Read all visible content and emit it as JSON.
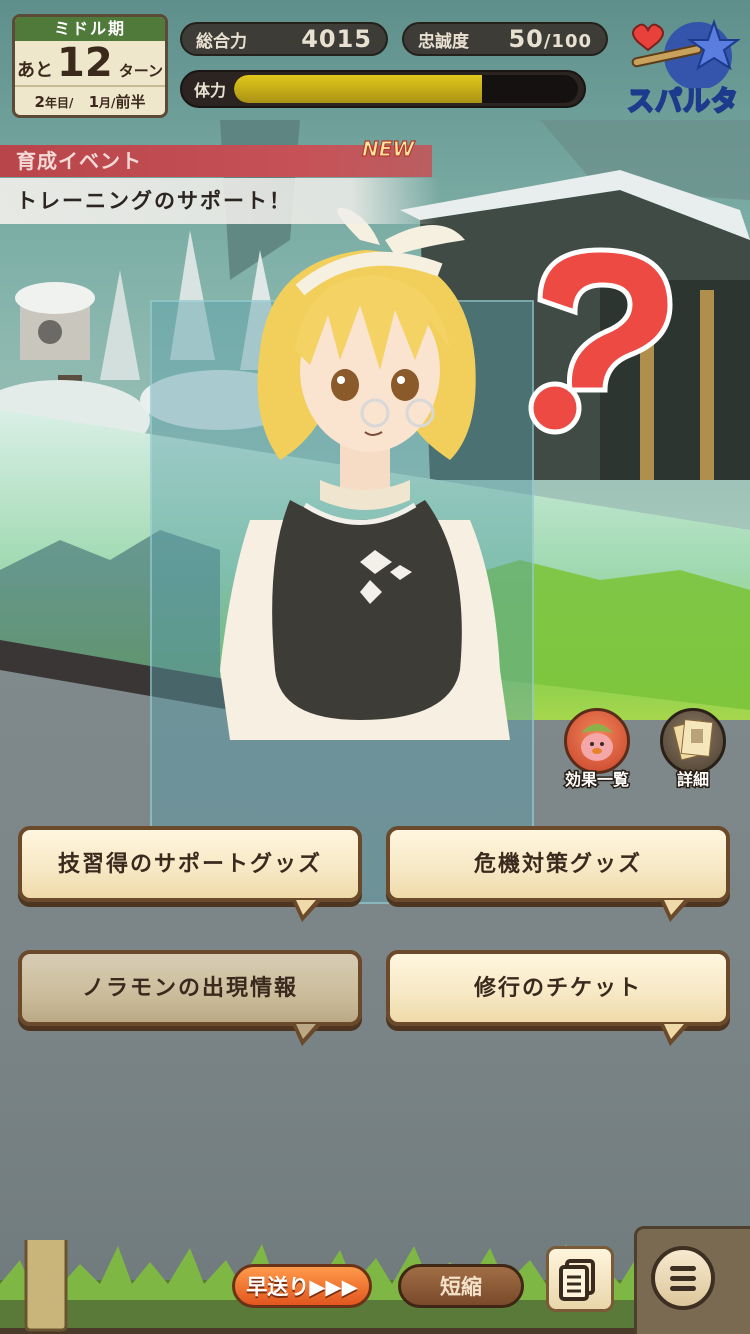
{
  "hud": {
    "period": "ミドル期",
    "turns_prefix": "あと",
    "turns_remaining": "12",
    "turns_suffix": "ターン",
    "year": "2",
    "year_unit": "年目/",
    "month": "1",
    "month_unit": "月/",
    "half": "前半",
    "total_power_label": "総合力",
    "total_power_value": "4015",
    "loyalty_label": "忠誠度",
    "loyalty_value": "50",
    "loyalty_max": "/100",
    "stamina_label": "体力",
    "stamina_level": 0.72,
    "mode": "スパルタ"
  },
  "event": {
    "category": "育成イベント",
    "new_badge": "NEW",
    "title": "トレーニングのサポート！"
  },
  "side_buttons": {
    "effects": "効果一覧",
    "details": "詳細"
  },
  "choices": [
    {
      "label": "技習得のサポートグッズ"
    },
    {
      "label": "危機対策グッズ"
    },
    {
      "label": "ノラモンの出現情報"
    },
    {
      "label": "修行のチケット"
    }
  ],
  "bottom": {
    "fast_forward": "早送り▶▶▶",
    "shorten": "短縮"
  },
  "colors": {
    "stamina_fill": "#c9b41a",
    "event_header": "#c65257",
    "mode_text_outline": "#1d3a8c"
  }
}
